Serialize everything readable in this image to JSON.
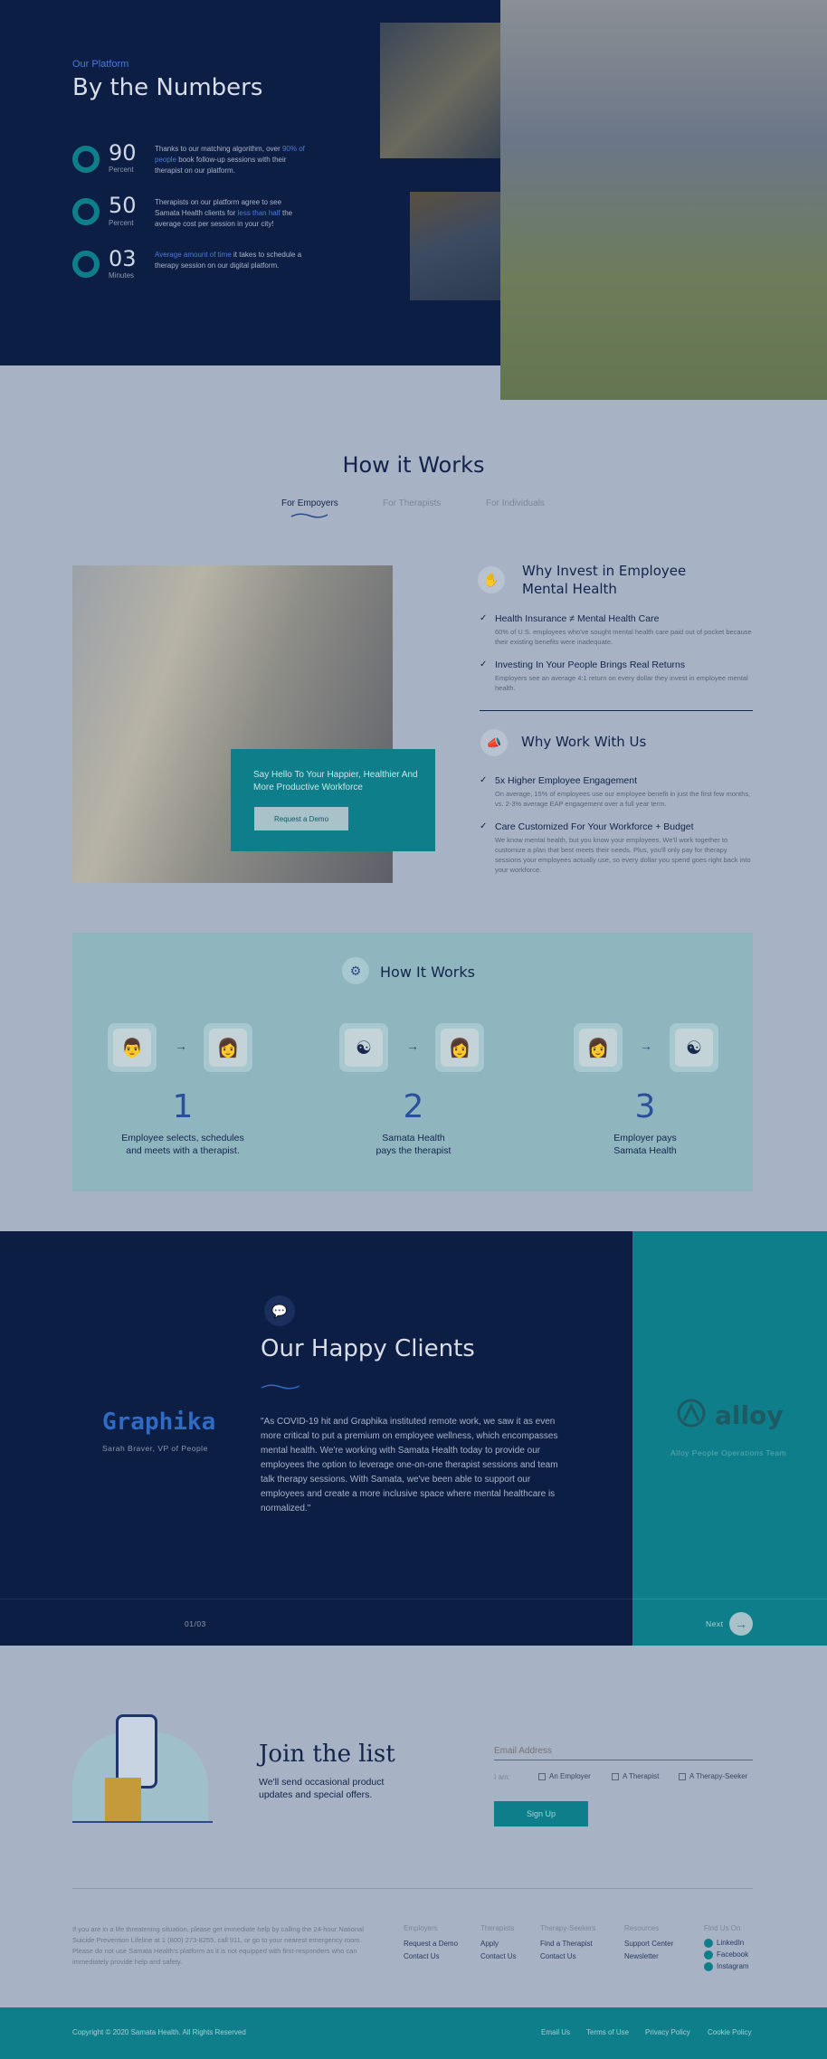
{
  "numbers": {
    "eyebrow": "Our Platform",
    "title": "By the Numbers",
    "stats": [
      {
        "value": "90",
        "unit": "Percent",
        "text_a": "Thanks to our matching algorithm, over ",
        "highlight": "90% of people",
        "text_b": " book follow-up sessions with their therapist on our platform."
      },
      {
        "value": "50",
        "unit": "Percent",
        "text_a": "Therapists on our platform agree to see Samata Health clients for ",
        "highlight": "less than half",
        "text_b": " the average cost per session in your city!"
      },
      {
        "value": "03",
        "unit": "Minutes",
        "text_a": "",
        "highlight": "Average amount of time",
        "text_b": " it takes to schedule a therapy session on our digital platform."
      }
    ]
  },
  "how": {
    "title": "How it Works",
    "tabs": [
      "For Empoyers",
      "For Therapists",
      "For Individuals"
    ],
    "card_text": "Say Hello To Your Happier, Healthier And More Productive Workforce",
    "demo_button": "Request a Demo",
    "invest_title": "Why Invest in Employee Mental Health",
    "invest_points": [
      {
        "title": "Health Insurance ≠ Mental Health Care",
        "text": "60% of U.S. employees who've sought mental health care paid out of pocket because their existing benefits were inadequate."
      },
      {
        "title": "Investing In Your People Brings Real Returns",
        "text": "Employers see an average 4:1 return on every dollar they invest in employee mental health."
      }
    ],
    "work_title": "Why Work With Us",
    "work_points": [
      {
        "title": "5x Higher Employee Engagement",
        "text": "On average, 15% of employees use our employee benefit in just the first few months, vs. 2-3% average EAP engagement over a full year term."
      },
      {
        "title": "Care Customized For Your Workforce + Budget",
        "text": "We know mental health, but you know your employees. We'll work together to customize a plan that best meets their needs. Plus, you'll only pay for therapy sessions your employees actually use, so every dollar you spend goes right back into your workforce."
      }
    ]
  },
  "steps": {
    "title": "How It Works",
    "items": [
      {
        "num": "1",
        "line1": "Employee selects, schedules",
        "line2": "and meets with a therapist."
      },
      {
        "num": "2",
        "line1": "Samata Health",
        "line2": "pays the therapist"
      },
      {
        "num": "3",
        "line1": "Employer pays",
        "line2": "Samata Health"
      }
    ]
  },
  "clients": {
    "title": "Our Happy Clients",
    "logo_left": "Graphika",
    "caption_left": "Sarah Braver, VP of People",
    "quote": "\"As COVID-19 hit and Graphika instituted remote work, we saw it as even more critical to put a premium on employee wellness, which encompasses mental health. We're working with Samata Health today to provide our employees the option to leverage one-on-one therapist sessions and team talk therapy sessions. With Samata, we've been able to support our employees and create a more inclusive space where mental healthcare is normalized.\"",
    "counter": "01/03",
    "logo_right": "alloy",
    "caption_right": "Alloy People Operations Team",
    "next": "Next"
  },
  "join": {
    "title": "Join the list",
    "subtitle": "We'll send occasional product updates and special offers.",
    "email_placeholder": "Email Address",
    "i_am": "I am:",
    "options": [
      "An Employer",
      "A Therapist",
      "A Therapy-Seeker"
    ],
    "signup": "Sign Up"
  },
  "footer": {
    "disclaimer": "If you are in a life threatening situation, please get immediate help by calling the 24-hour National Suicide Prevention Lifeline at 1 (800) 273-8255, call 911, or go to your nearest emergency room. Please do not use Samata Health's platform as it is not equipped with first-responders who can immediately provide help and safety.",
    "columns": [
      {
        "head": "Employers",
        "links": [
          "Request a Demo",
          "Contact Us"
        ]
      },
      {
        "head": "Therapists",
        "links": [
          "Apply",
          "Contact Us"
        ]
      },
      {
        "head": "Therapy-Seekers",
        "links": [
          "Find a Therapist",
          "Contact Us"
        ]
      },
      {
        "head": "Resources",
        "links": [
          "Support Center",
          "Newsletter"
        ]
      },
      {
        "head": "Find Us On",
        "links": [
          "LinkedIn",
          "Facebook",
          "Instagram"
        ]
      }
    ],
    "copyright": "Copyright © 2020 Samata Health. All Rights Reserved",
    "bottom_links": [
      "Email Us",
      "Terms of Use",
      "Privacy Policy",
      "Cookie Policy"
    ]
  },
  "colors": {
    "navy": "#0d1e45",
    "teal": "#0e7f8a",
    "accent_blue": "#4b7ad6",
    "page_bg": "#a7b2c4"
  }
}
